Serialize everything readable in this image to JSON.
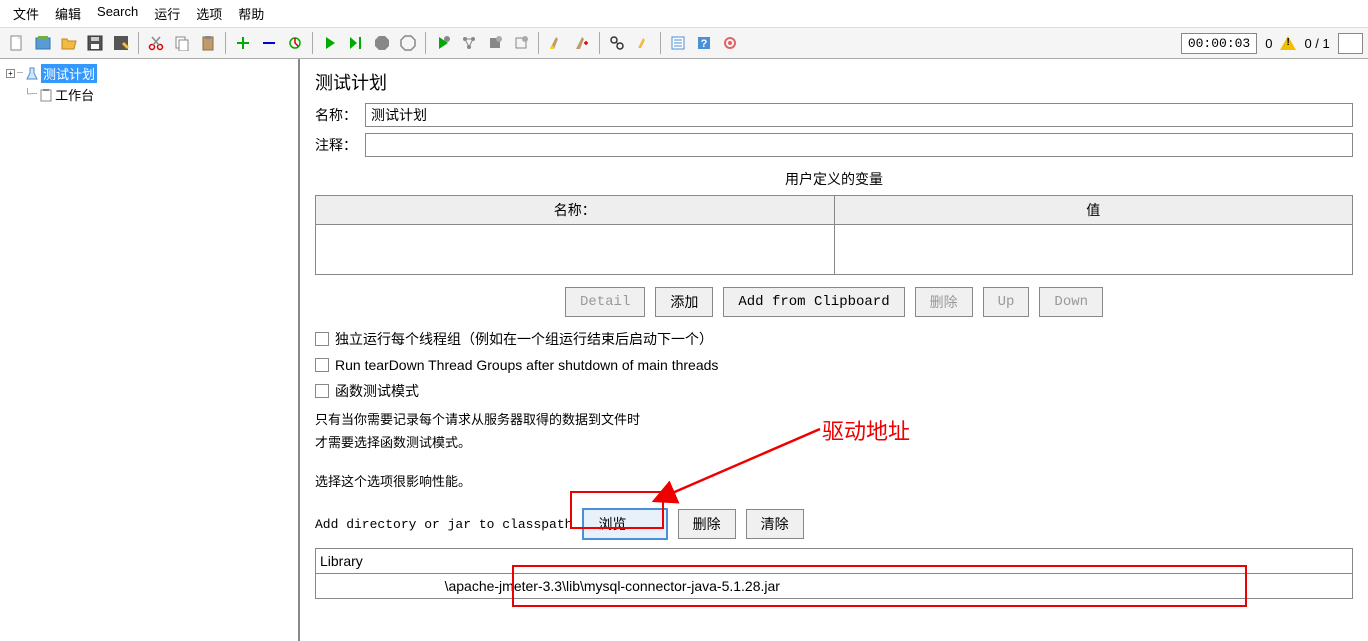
{
  "menu": {
    "file": "文件",
    "edit": "编辑",
    "search": "Search",
    "run": "运行",
    "options": "选项",
    "help": "帮助"
  },
  "toolbar_right": {
    "timer": "00:00:03",
    "warn_count": "0",
    "ratio": "0 / 1"
  },
  "tree": {
    "root": "测试计划",
    "child": "工作台"
  },
  "panel": {
    "title": "测试计划",
    "name_label": "名称：",
    "name_value": "测试计划",
    "comment_label": "注释：",
    "comment_value": "",
    "vars_title": "用户定义的变量",
    "col_name": "名称：",
    "col_value": "值",
    "btn_detail": "Detail",
    "btn_add": "添加",
    "btn_clip": "Add from Clipboard",
    "btn_del": "删除",
    "btn_up": "Up",
    "btn_down": "Down",
    "chk1": "独立运行每个线程组（例如在一个组运行结束后启动下一个）",
    "chk2": "Run tearDown Thread Groups after shutdown of main threads",
    "chk3": "函数测试模式",
    "note1": "只有当你需要记录每个请求从服务器取得的数据到文件时",
    "note2": "才需要选择函数测试模式。",
    "note3": "选择这个选项很影响性能。",
    "classpath_label": "Add directory or jar to classpath",
    "btn_browse": "浏览...",
    "btn_del2": "删除",
    "btn_clear": "清除",
    "lib_header": "Library",
    "lib_path": "\\apache-jmeter-3.3\\lib\\mysql-connector-java-5.1.28.jar"
  },
  "annotation": {
    "driver": "驱动地址"
  }
}
